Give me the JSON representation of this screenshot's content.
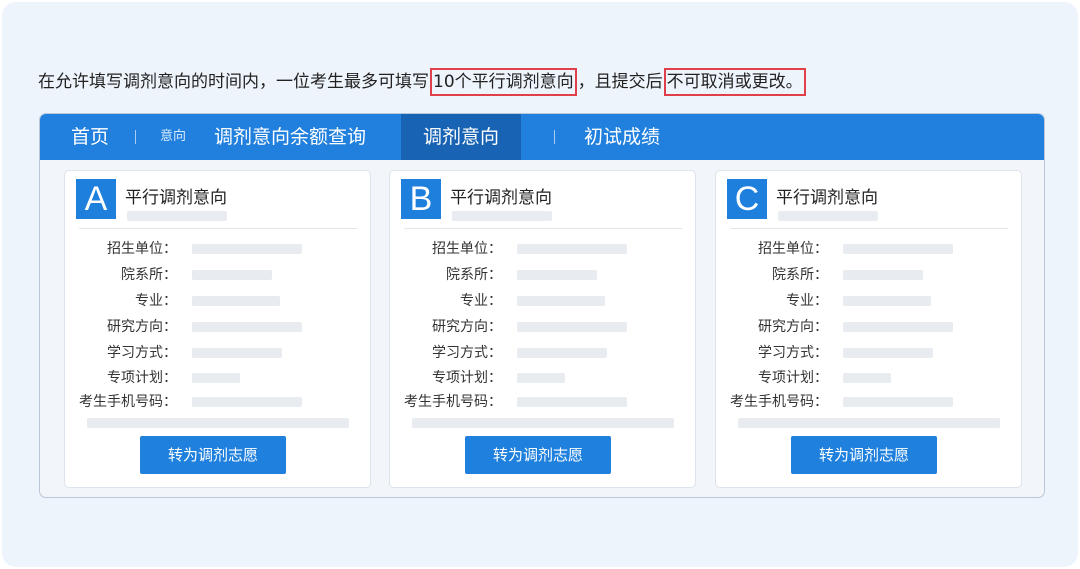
{
  "intro": {
    "part1": "在允许填写调剂意向的时间内，一位考生最多可填写",
    "highlight1": "10个平行调剂意向",
    "part2": "，且提交后",
    "highlight2": "不可取消或更改。"
  },
  "nav": {
    "home": "首页",
    "small_label": "意向",
    "balance_query": "调剂意向余额查询",
    "adjust_intent": "调剂意向",
    "initial_scores": "初试成绩"
  },
  "cards": [
    {
      "badge": "A",
      "title": "平行调剂意向",
      "fields": [
        "招生单位：",
        "院系所：",
        "专业：",
        "研究方向：",
        "学习方式：",
        "专项计划：",
        "考生手机号码："
      ],
      "button": "转为调剂志愿"
    },
    {
      "badge": "B",
      "title": "平行调剂意向",
      "fields": [
        "招生单位：",
        "院系所：",
        "专业：",
        "研究方向：",
        "学习方式：",
        "专项计划：",
        "考生手机号码："
      ],
      "button": "转为调剂志愿"
    },
    {
      "badge": "C",
      "title": "平行调剂意向",
      "fields": [
        "招生单位：",
        "院系所：",
        "专业：",
        "研究方向：",
        "学习方式：",
        "专项计划：",
        "考生手机号码："
      ],
      "button": "转为调剂志愿"
    }
  ],
  "colors": {
    "accent": "#2180dd",
    "nav_active": "#1863b3",
    "highlight_border": "#e0404a",
    "background": "#eef4fc"
  }
}
